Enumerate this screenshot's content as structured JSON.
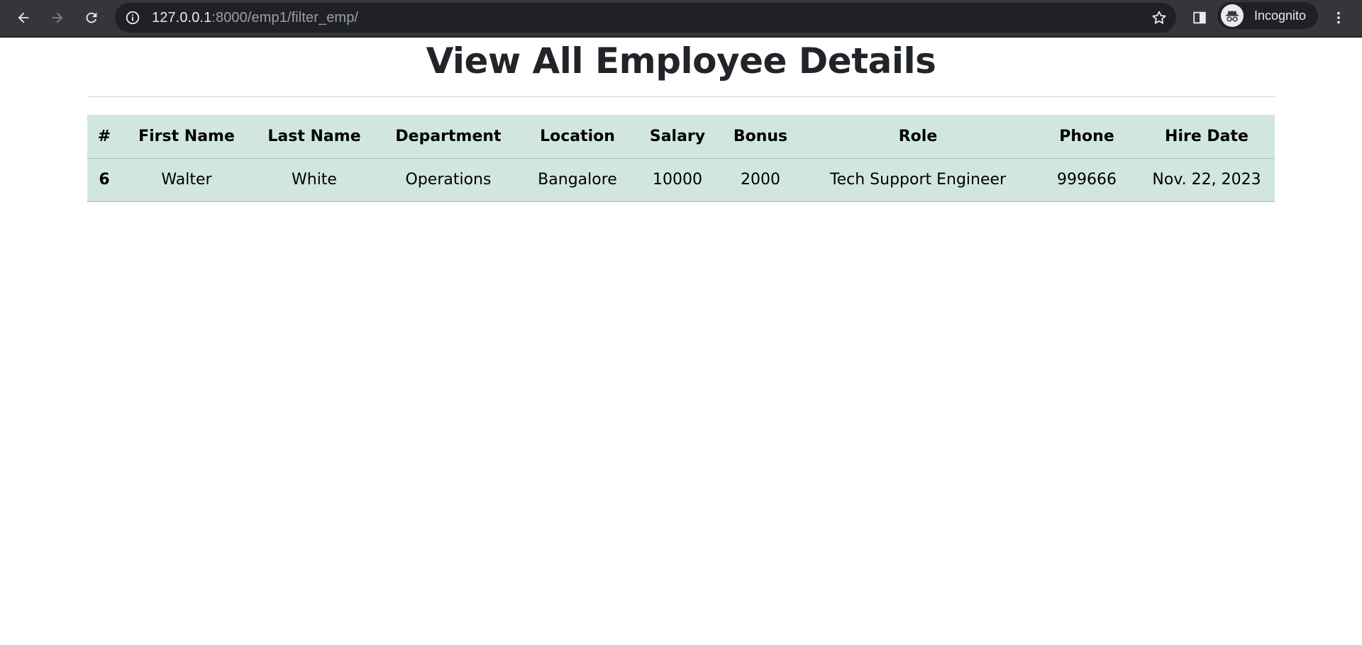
{
  "browser": {
    "url_host": "127.0.0.1",
    "url_path": ":8000/emp1/filter_emp/",
    "profile_label": "Incognito"
  },
  "page": {
    "title": "View All Employee Details"
  },
  "table": {
    "headers": [
      "#",
      "First Name",
      "Last Name",
      "Department",
      "Location",
      "Salary",
      "Bonus",
      "Role",
      "Phone",
      "Hire Date"
    ],
    "rows": [
      [
        "6",
        "Walter",
        "White",
        "Operations",
        "Bangalore",
        "10000",
        "2000",
        "Tech Support Engineer",
        "999666",
        "Nov. 22, 2023"
      ]
    ]
  },
  "colors": {
    "table_bg": "#d1e7dd",
    "toolbar_bg": "#35363a",
    "omnibox_bg": "#202124"
  }
}
